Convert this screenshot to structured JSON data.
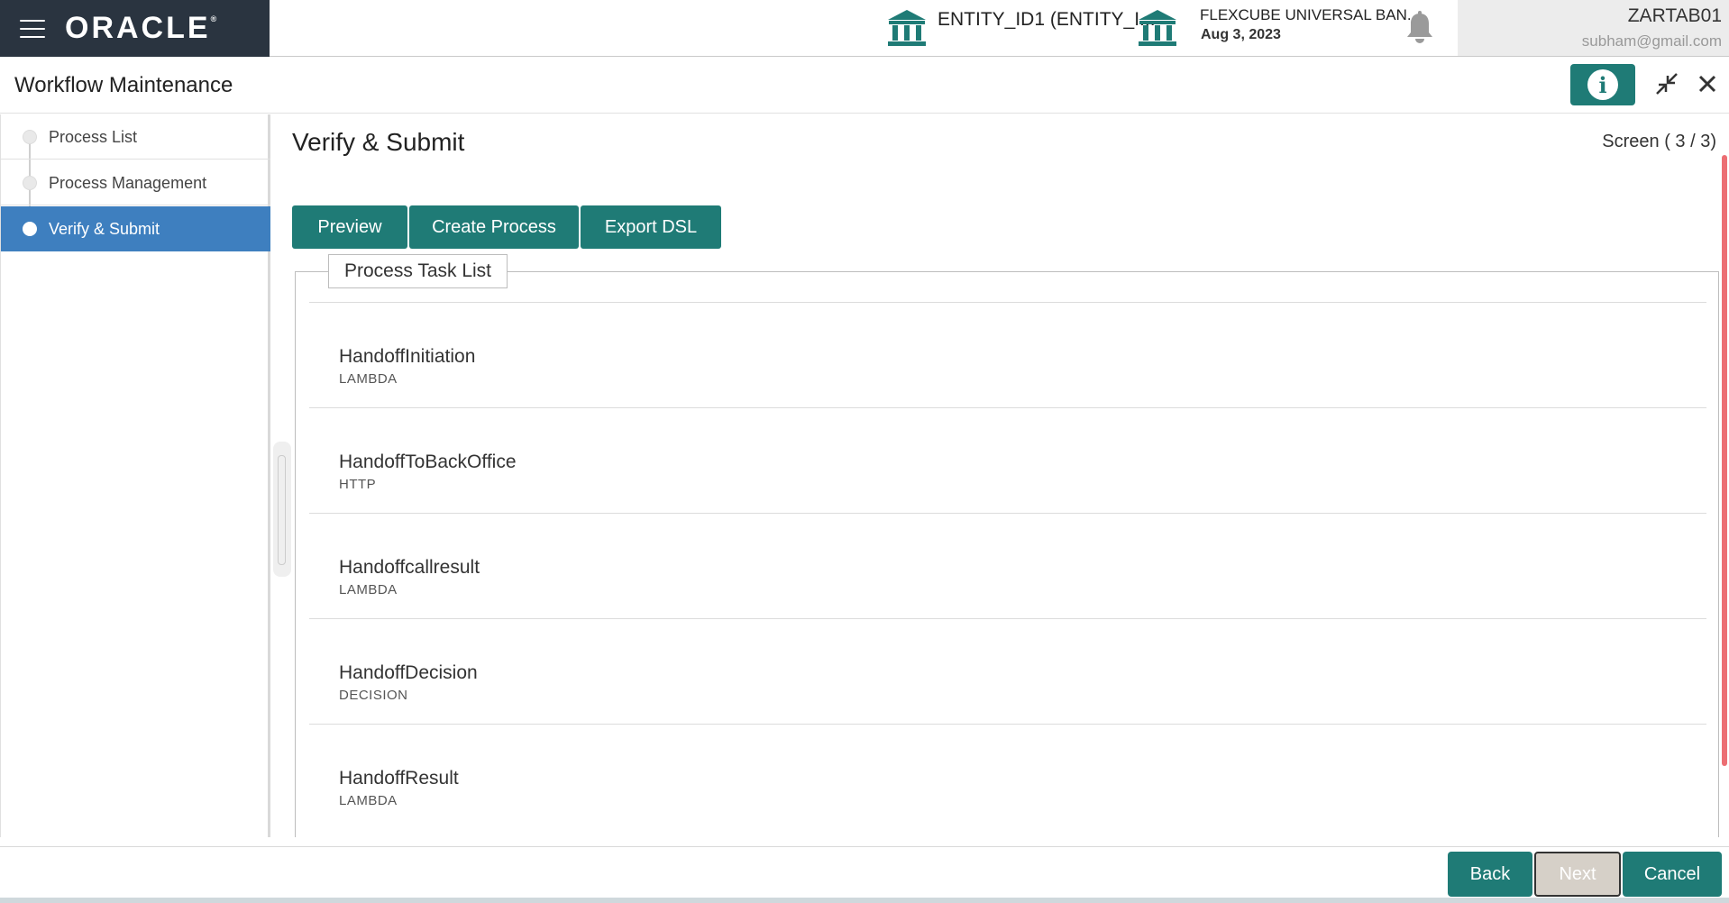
{
  "header": {
    "brand": "ORACLE",
    "brand_mark": "®",
    "entity": "ENTITY_ID1  (ENTITY_I...",
    "branch_name": "FLEXCUBE UNIVERSAL BAN...",
    "branch_date": "Aug 3, 2023",
    "user_id": "ZARTAB01",
    "user_email": "subham@gmail.com"
  },
  "titlebar": {
    "title": "Workflow Maintenance",
    "info_label": "i"
  },
  "sidebar": {
    "items": [
      {
        "label": "Process List"
      },
      {
        "label": "Process Management"
      },
      {
        "label": "Verify & Submit"
      }
    ]
  },
  "main": {
    "title": "Verify & Submit",
    "screen": "Screen ( 3 / 3)",
    "actions": {
      "preview": "Preview",
      "create_process": "Create Process",
      "export_dsl": "Export DSL"
    },
    "task_list_title": "Process Task List",
    "tasks": [
      {
        "name": "HandoffInitiation",
        "type": "LAMBDA"
      },
      {
        "name": "HandoffToBackOffice",
        "type": "HTTP"
      },
      {
        "name": "Handoffcallresult",
        "type": "LAMBDA"
      },
      {
        "name": "HandoffDecision",
        "type": "DECISION"
      },
      {
        "name": "HandoffResult",
        "type": "LAMBDA"
      }
    ]
  },
  "footer": {
    "back": "Back",
    "next": "Next",
    "cancel": "Cancel"
  },
  "colors": {
    "primary": "#1f7b76",
    "active_nav": "#3e7fbf",
    "brand_bg": "#2a3440"
  }
}
